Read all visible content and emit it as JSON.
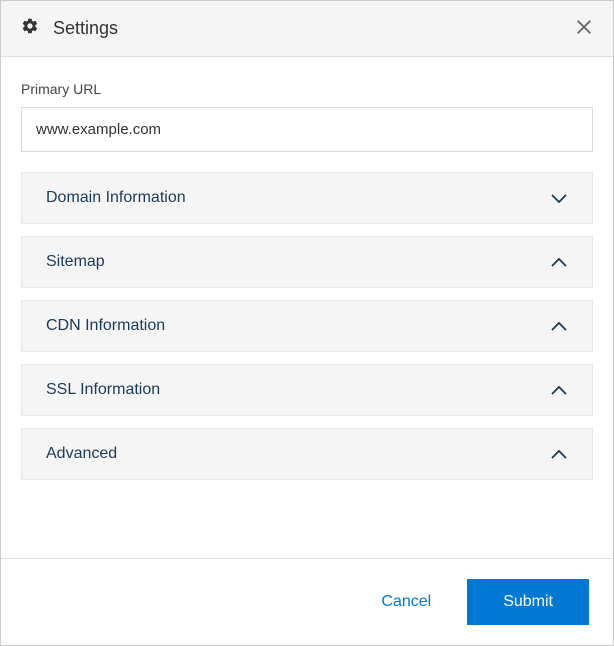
{
  "dialog": {
    "title": "Settings"
  },
  "field": {
    "primary_url_label": "Primary URL",
    "primary_url_value": "www.example.com"
  },
  "accordion": {
    "items": [
      {
        "label": "Domain Information",
        "expanded": false
      },
      {
        "label": "Sitemap",
        "expanded": true
      },
      {
        "label": "CDN Information",
        "expanded": true
      },
      {
        "label": "SSL Information",
        "expanded": true
      },
      {
        "label": "Advanced",
        "expanded": true
      }
    ]
  },
  "footer": {
    "cancel_label": "Cancel",
    "submit_label": "Submit"
  }
}
